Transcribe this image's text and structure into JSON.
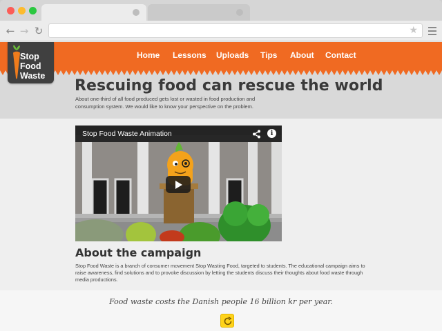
{
  "site": {
    "logo_line1": "Stop",
    "logo_line2": "Food",
    "logo_line3": "Waste",
    "nav": [
      "Home",
      "Lessons",
      "Uploads",
      "Tips",
      "About",
      "Contact"
    ]
  },
  "hero": {
    "title": "Rescuing food can rescue the world",
    "description": "About one-third of all food produced gets lost or wasted in food production and consumption system. We would like to know your perspective on the problem."
  },
  "video": {
    "title": "Stop Food Waste Animation",
    "share_icon": "share-icon",
    "info_icon": "info-icon",
    "info_glyph": "i"
  },
  "about": {
    "title": "About the campaign",
    "text": "Stop Food Waste is a branch of consumer movement Stop Wasting Food, targeted to students. The educational campaign aims to raise awareness, find solutions and to provoke discussion by letting the students discuss their thoughts about food waste through media productions."
  },
  "quote": {
    "text": "Food waste costs the Danish people 16 billion kr per year."
  },
  "colors": {
    "brand_orange": "#f06a22",
    "logo_bg": "#404040",
    "refresh_yellow": "#ffd31a"
  }
}
